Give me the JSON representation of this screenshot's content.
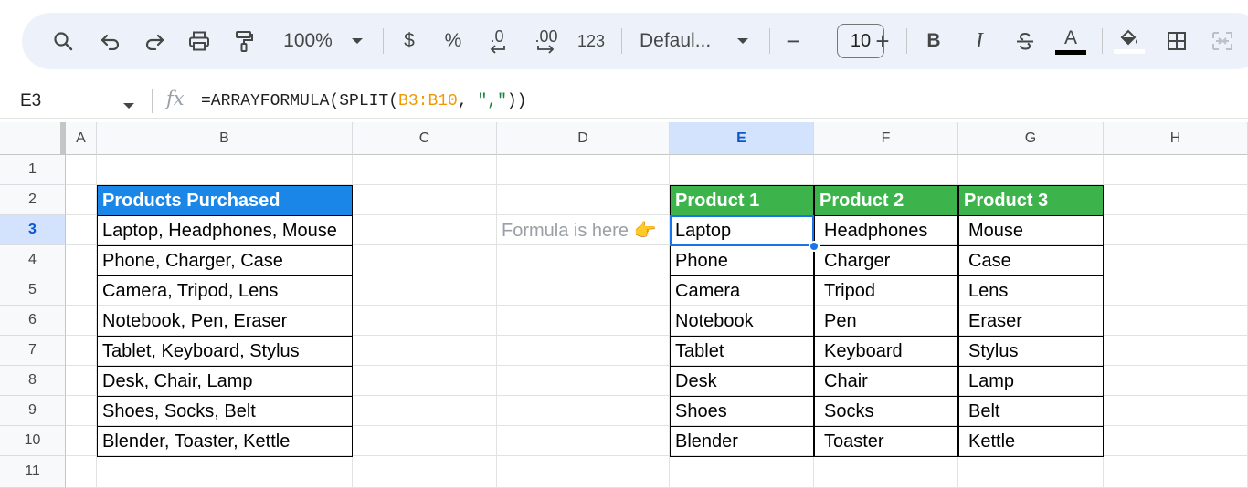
{
  "toolbar": {
    "zoom": "100%",
    "currency": "$",
    "percent": "%",
    "decrease_decimal": ".0",
    "increase_decimal": ".00",
    "more_formats": "123",
    "font": "Defaul...",
    "font_size": "10",
    "minus": "−",
    "plus": "+",
    "bold": "B",
    "italic": "I",
    "text_color": "A"
  },
  "formula_bar": {
    "cell_ref": "E3",
    "fx": "fx",
    "formula_prefix": "=ARRAYFORMULA(SPLIT(",
    "formula_range": "B3:B10",
    "formula_mid": ", ",
    "formula_string": "\",\"",
    "formula_suffix": "))"
  },
  "columns": [
    "A",
    "B",
    "C",
    "D",
    "E",
    "F",
    "G",
    "H"
  ],
  "rows": [
    "1",
    "2",
    "3",
    "4",
    "5",
    "6",
    "7",
    "8",
    "9",
    "10",
    "11"
  ],
  "sheet": {
    "b_header": "Products Purchased",
    "b_values": [
      "Laptop, Headphones, Mouse",
      "Phone, Charger, Case",
      "Camera, Tripod, Lens",
      "Notebook, Pen, Eraser",
      "Tablet, Keyboard, Stylus",
      "Desk, Chair, Lamp",
      "Shoes, Socks, Belt",
      "Blender, Toaster, Kettle"
    ],
    "note": "Formula is here 👉",
    "e_header": "Product 1",
    "f_header": "Product 2",
    "g_header": "Product 3",
    "e_values": [
      "Laptop",
      "Phone",
      "Camera",
      "Notebook",
      "Tablet",
      "Desk",
      "Shoes",
      "Blender"
    ],
    "f_values": [
      "Headphones",
      "Charger",
      "Tripod",
      "Pen",
      "Keyboard",
      "Chair",
      "Socks",
      "Toaster"
    ],
    "g_values": [
      "Mouse",
      "Case",
      "Lens",
      "Eraser",
      "Stylus",
      "Lamp",
      "Belt",
      "Kettle"
    ]
  },
  "colors": {
    "header_blue": "#1a86e8",
    "header_green": "#3cb44b",
    "selection": "#1a73e8"
  }
}
